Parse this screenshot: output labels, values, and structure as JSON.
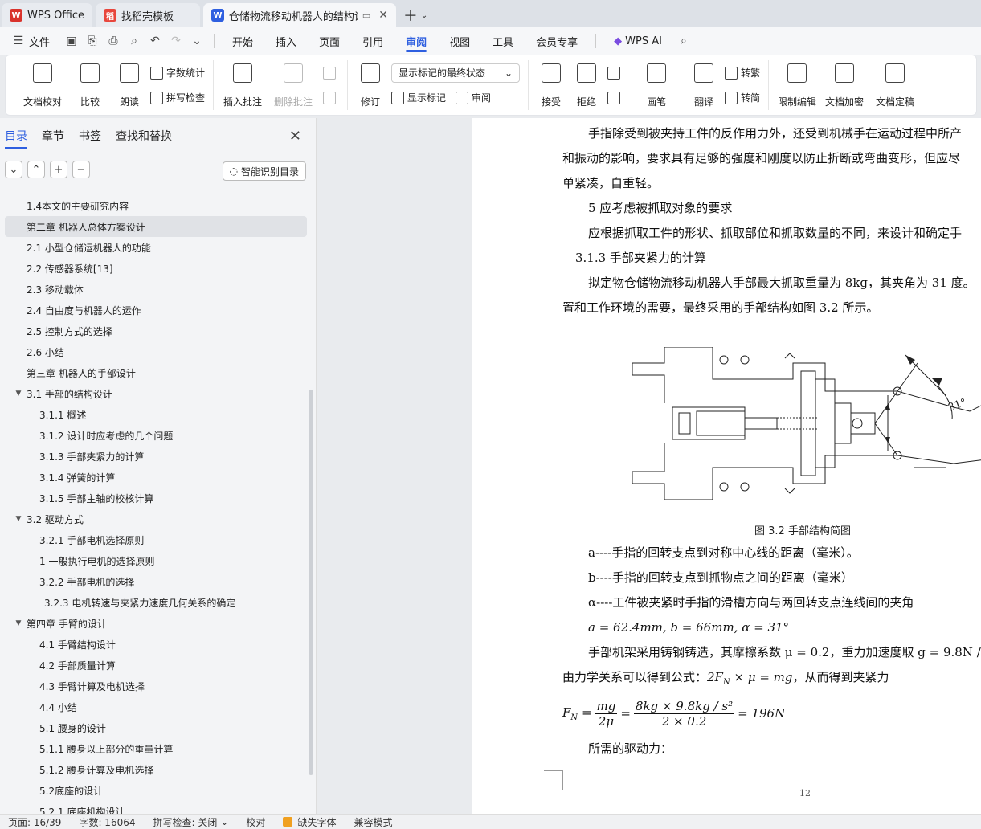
{
  "tabs": [
    {
      "label": "WPS Office",
      "logo": "W",
      "color": "#d9322b"
    },
    {
      "label": "找稻壳模板",
      "logo": "稻",
      "color": "#e8463c"
    },
    {
      "label": "仓储物流移动机器人的结构设",
      "logo": "W",
      "color": "#2e5fe0",
      "active": true
    }
  ],
  "menubar": {
    "file": "文件",
    "items": [
      "开始",
      "插入",
      "页面",
      "引用",
      "审阅",
      "视图",
      "工具",
      "会员专享"
    ],
    "active": "审阅",
    "ai": "WPS AI"
  },
  "ribbon": {
    "proofread": "文档校对",
    "compare": "比较",
    "read_aloud": "朗读",
    "word_count": "字数统计",
    "spell_check": "拼写检查",
    "insert_comment": "插入批注",
    "delete_comment": "删除批注",
    "revise": "修订",
    "markup_state": "显示标记的最终状态",
    "show_markup": "显示标记",
    "review": "审阅",
    "accept": "接受",
    "reject": "拒绝",
    "pen": "画笔",
    "translate": "翻译",
    "to_traditional": "转繁",
    "to_simplified": "转简",
    "restrict_edit": "限制编辑",
    "encrypt": "文档加密",
    "finalize": "文档定稿"
  },
  "nav": {
    "tabs": [
      "目录",
      "章节",
      "书签",
      "查找和替换"
    ],
    "smart_button": "智能识别目录",
    "toc": [
      {
        "label": "1.4本文的主要研究内容",
        "level": 1
      },
      {
        "label": "第二章  机器人总体方案设计",
        "level": 1,
        "selected": true
      },
      {
        "label": "2.1  小型仓储运机器人的功能",
        "level": 1
      },
      {
        "label": "2.2  传感器系统[13]",
        "level": 1
      },
      {
        "label": "2.3  移动载体",
        "level": 1
      },
      {
        "label": "2.4  自由度与机器人的运作",
        "level": 1
      },
      {
        "label": "2.5  控制方式的选择",
        "level": 1
      },
      {
        "label": "2.6  小结",
        "level": 1
      },
      {
        "label": "第三章    机器人的手部设计",
        "level": 1
      },
      {
        "label": "3.1  手部的结构设计",
        "level": 1,
        "expanded": true
      },
      {
        "label": "3.1.1  概述",
        "level": 2
      },
      {
        "label": "3.1.2  设计时应考虑的几个问题",
        "level": 2
      },
      {
        "label": "3.1.3  手部夹紧力的计算",
        "level": 2
      },
      {
        "label": "3.1.4  弹簧的计算",
        "level": 2
      },
      {
        "label": "3.1.5  手部主轴的校核计算",
        "level": 2
      },
      {
        "label": "3.2  驱动方式",
        "level": 1,
        "expanded": true
      },
      {
        "label": "3.2.1  手部电机选择原则",
        "level": 2
      },
      {
        "label": "1  一般执行电机的选择原则",
        "level": 2
      },
      {
        "label": "3.2.2  手部电机的选择",
        "level": 2
      },
      {
        "label": "3.2.3  电机转速与夹紧力速度几何关系的确定",
        "level": 3
      },
      {
        "label": "第四章    手臂的设计",
        "level": 1,
        "expanded": true
      },
      {
        "label": "4.1  手臂结构设计",
        "level": 2
      },
      {
        "label": "4.2  手部质量计算",
        "level": 2
      },
      {
        "label": "4.3  手臂计算及电机选择",
        "level": 2
      },
      {
        "label": "4.4    小结",
        "level": 2
      },
      {
        "label": "5.1  腰身的设计",
        "level": 2
      },
      {
        "label": "5.1.1  腰身以上部分的重量计算",
        "level": 2
      },
      {
        "label": "5.1.2  腰身计算及电机选择",
        "level": 2
      },
      {
        "label": "5.2底座的设计",
        "level": 2
      },
      {
        "label": "5.2.1  底座机构设计",
        "level": 2
      }
    ]
  },
  "doc": {
    "p1": "手指除受到被夹持工件的反作用力外，还受到机械手在运动过程中所产",
    "p2": "和振动的影响，要求具有足够的强度和刚度以防止折断或弯曲变形，但应尽",
    "p3": "单紧凑，自重轻。",
    "p4": "5  应考虑被抓取对象的要求",
    "p5": "应根据抓取工件的形状、抓取部位和抓取数量的不同，来设计和确定手",
    "h313": "3.1.3  手部夹紧力的计算",
    "p6": "拟定物仓储物流移动机器人手部最大抓取重量为 8kg，其夹角为 31 度。",
    "p7": "置和工作环境的需要，最终采用的手部结构如图 3.2 所示。",
    "figure_angle": "31°",
    "caption": "图 3.2  手部结构简图",
    "a_def": "a----手指的回转支点到对称中心线的距离（毫米）。",
    "b_def": "b----手指的回转支点到抓物点之间的距离（毫米）",
    "alpha_def": "α----工件被夹紧时手指的滑槽方向与两回转支点连线间的夹角",
    "values": "a = 62.4mm, b = 66mm, α = 31°",
    "friction": "手部机架采用铸钢铸造，其摩擦系数 μ = 0.2，重力加速度取 g = 9.8N /",
    "mech": "由力学关系可以得到公式：",
    "mech_formula": "2F",
    "mech_formula_rest": " × μ = mg",
    "mech_tail": "，从而得到夹紧力",
    "fn_lhs": "F",
    "fn_frac1_num": "mg",
    "fn_frac1_den": "2μ",
    "fn_frac2_num": "8kg × 9.8kg / s²",
    "fn_frac2_den": "2 × 0.2",
    "fn_result": "= 196N",
    "drive": "所需的驱动力：",
    "page_number": "12"
  },
  "status": {
    "page": "页面: 16/39",
    "words": "字数: 16064",
    "spell": "拼写检查: 关闭",
    "proof": "校对",
    "missing_font": "缺失字体",
    "compat": "兼容模式"
  }
}
